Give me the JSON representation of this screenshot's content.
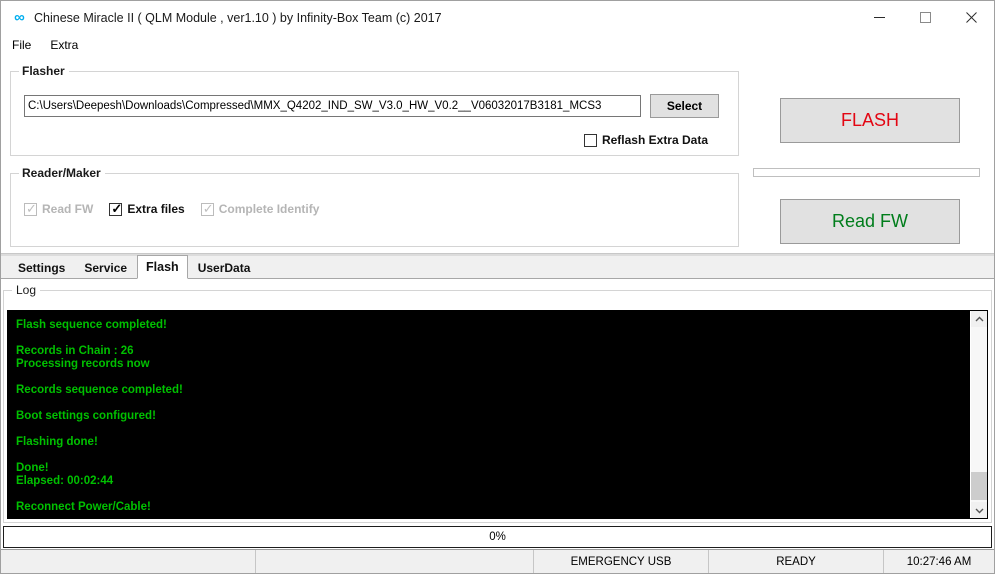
{
  "window": {
    "title": "Chinese Miracle II ( QLM Module , ver1.10  ) by Infinity-Box Team (c) 2017",
    "icon": "infinity-icon",
    "minimize_label": "minimize-icon",
    "maximize_label": "maximize-icon",
    "close_label": "close-icon"
  },
  "menu": {
    "items": [
      {
        "label": "File"
      },
      {
        "label": "Extra"
      }
    ]
  },
  "flasher": {
    "legend": "Flasher",
    "path_value": "C:\\Users\\Deepesh\\Downloads\\Compressed\\MMX_Q4202_IND_SW_V3.0_HW_V0.2__V06032017B3181_MCS3",
    "path_placeholder": "",
    "select_label": "Select",
    "reflash_extra_data": {
      "label": "Reflash Extra Data",
      "checked": false,
      "enabled": true
    }
  },
  "reader_maker": {
    "legend": "Reader/Maker",
    "checkboxes": [
      {
        "label": "Read FW",
        "checked": true,
        "enabled": false
      },
      {
        "label": "Extra files",
        "checked": true,
        "enabled": true
      },
      {
        "label": "Complete Identify",
        "checked": true,
        "enabled": false
      }
    ]
  },
  "actions": {
    "flash_label": "FLASH",
    "flash_color": "#e30613",
    "read_fw_label": "Read FW",
    "read_fw_color": "#007d1b",
    "side_progress_percent": 0
  },
  "tabs": [
    {
      "label": "Settings",
      "active": false
    },
    {
      "label": "Service",
      "active": false
    },
    {
      "label": "Flash",
      "active": true
    },
    {
      "label": "UserData",
      "active": false
    }
  ],
  "log": {
    "legend": "Log",
    "text_color": "#00c000",
    "background": "#000000",
    "lines": [
      "Flash sequence completed!",
      "",
      "Records in Chain : 26",
      "Processing records now",
      "",
      "Records sequence completed!",
      "",
      "Boot settings configured!",
      "",
      "Flashing done!",
      "",
      "Done!",
      "Elapsed: 00:02:44",
      "",
      "Reconnect Power/Cable!"
    ]
  },
  "progress": {
    "percent_label": "0%",
    "value": 0
  },
  "statusbar": {
    "cells": [
      {
        "text": ""
      },
      {
        "text": ""
      },
      {
        "text": "EMERGENCY USB"
      },
      {
        "text": "READY"
      },
      {
        "text": "10:27:46 AM"
      }
    ]
  }
}
